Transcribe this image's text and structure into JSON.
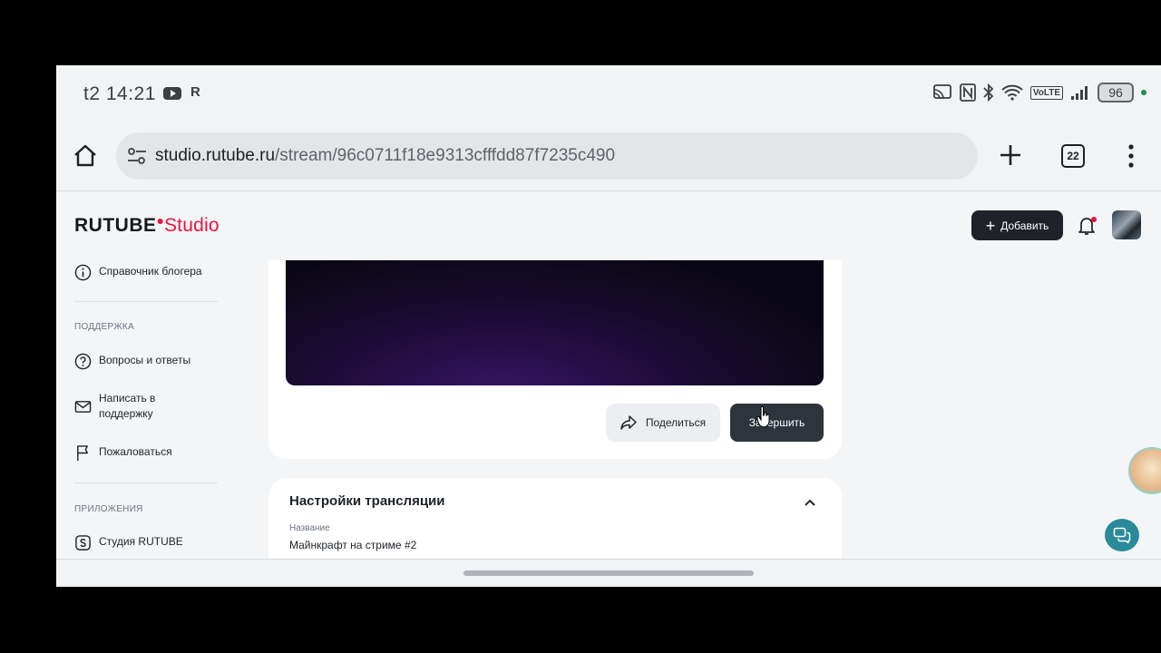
{
  "status_bar": {
    "time": "t2 14:21",
    "r_label": "R",
    "battery": "96"
  },
  "browser": {
    "url_host": "studio.rutube.ru",
    "url_path": "/stream/96c0711f18e9313cfffdd87f7235c490",
    "tab_count": "22"
  },
  "header": {
    "logo_rutube": "RUTUBE",
    "logo_studio": "Studio",
    "add_label": "Добавить"
  },
  "sidebar": {
    "blogger_guide": "Справочник блогера",
    "support_section": "ПОДДЕРЖКА",
    "faq": "Вопросы и ответы",
    "write_support": "Написать в поддержку",
    "complain": "Пожаловаться",
    "apps_section": "ПРИЛОЖЕНИЯ",
    "studio_app": "Студия RUTUBE"
  },
  "stream_card": {
    "share_label": "Поделиться",
    "finish_label": "Завершить"
  },
  "settings_card": {
    "title": "Настройки трансляции",
    "name_label": "Название",
    "name_value": "Майнкрафт на стриме #2"
  },
  "colors": {
    "brand_red": "#ed143b",
    "dark_button": "#1f2329",
    "chat_teal": "#2a8a99"
  }
}
